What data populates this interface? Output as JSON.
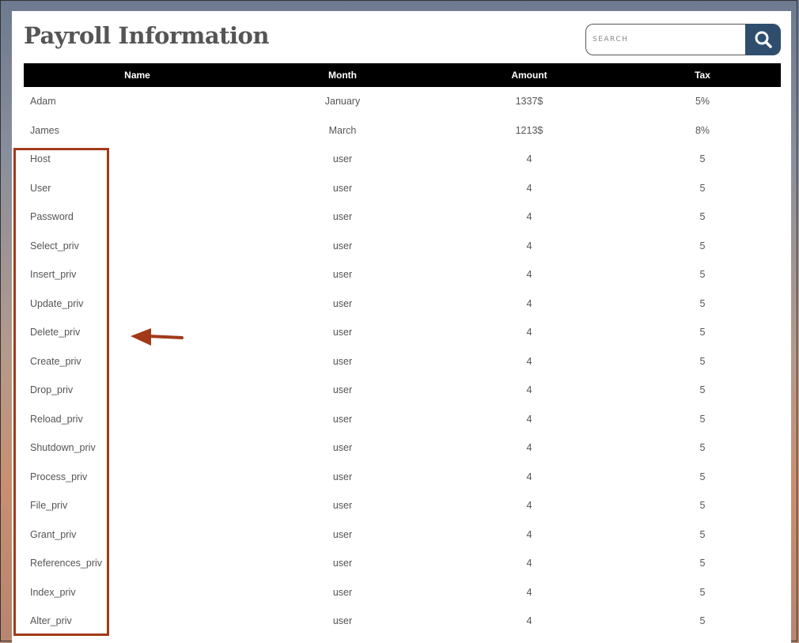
{
  "page": {
    "title": "Payroll Information"
  },
  "search": {
    "placeholder": "SEARCH",
    "icon": "search-icon"
  },
  "table": {
    "headers": [
      "Name",
      "Month",
      "Amount",
      "Tax"
    ],
    "rows": [
      [
        "Adam",
        "January",
        "1337$",
        "5%"
      ],
      [
        "James",
        "March",
        "1213$",
        "8%"
      ],
      [
        "Host",
        "user",
        "4",
        "5"
      ],
      [
        "User",
        "user",
        "4",
        "5"
      ],
      [
        "Password",
        "user",
        "4",
        "5"
      ],
      [
        "Select_priv",
        "user",
        "4",
        "5"
      ],
      [
        "Insert_priv",
        "user",
        "4",
        "5"
      ],
      [
        "Update_priv",
        "user",
        "4",
        "5"
      ],
      [
        "Delete_priv",
        "user",
        "4",
        "5"
      ],
      [
        "Create_priv",
        "user",
        "4",
        "5"
      ],
      [
        "Drop_priv",
        "user",
        "4",
        "5"
      ],
      [
        "Reload_priv",
        "user",
        "4",
        "5"
      ],
      [
        "Shutdown_priv",
        "user",
        "4",
        "5"
      ],
      [
        "Process_priv",
        "user",
        "4",
        "5"
      ],
      [
        "File_priv",
        "user",
        "4",
        "5"
      ],
      [
        "Grant_priv",
        "user",
        "4",
        "5"
      ],
      [
        "References_priv",
        "user",
        "4",
        "5"
      ],
      [
        "Index_priv",
        "user",
        "4",
        "5"
      ],
      [
        "Alter_priv",
        "user",
        "4",
        "5"
      ]
    ]
  },
  "annotations": {
    "highlight_color": "#a23a1a",
    "arrow_icon": "arrow-left-icon"
  },
  "colors": {
    "search_button": "#2f4e6e",
    "header_bg": "#000000",
    "title": "#555555"
  }
}
